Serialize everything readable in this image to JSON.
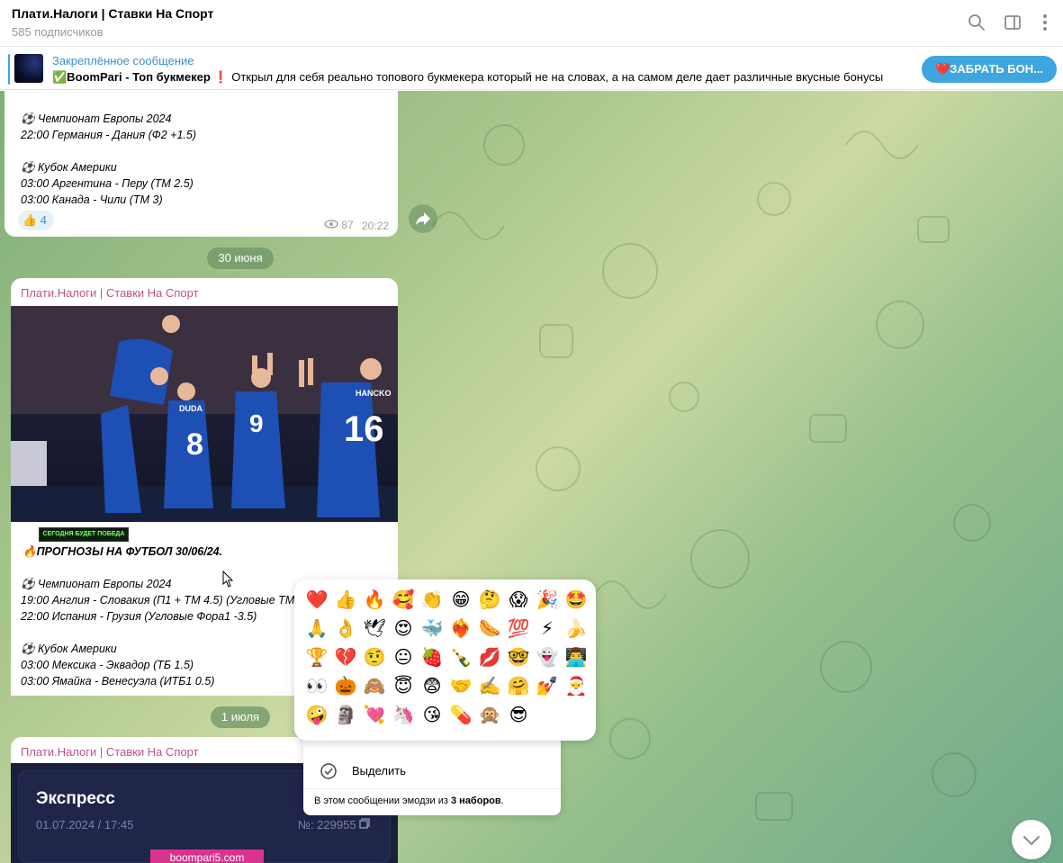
{
  "header": {
    "title": "Плати.Налоги | Ставки На Спорт",
    "subtitle": "585 подписчиков"
  },
  "pinned": {
    "label": "Закреплённое сообщение",
    "title_bold": "✅BoomPari - Топ букмекер",
    "text": " ❗ Открыл для себя реально топового букмекера который не на словах, а на самом деле дает различные вкусные бонусы",
    "button": "❤️ЗАБРАТЬ БОН..."
  },
  "msg1": {
    "lines": [
      "⚽ Чемпионат Европы 2024",
      "22:00 Германия - Дания (Ф2 +1.5)",
      "",
      "⚽ Кубок Америки",
      "03:00 Аргентина - Перу (ТМ 2.5)",
      "03:00 Канада - Чили (ТМ 3)"
    ],
    "reaction": "👍 4",
    "views": "87",
    "time": "20:22"
  },
  "date1": "30 июня",
  "msg2": {
    "sender": "Плати.Налоги | Ставки На Спорт",
    "banner": "СЕГОДНЯ БУДЕТ ПОБЕДА",
    "headline": "🔥ПРОГНОЗЫ НА ФУТБОЛ 30/06/24.",
    "lines": [
      "⚽ Чемпионат Европы 2024",
      "19:00 Англия - Словакия (П1 + ТМ 4.5) (Угловые ТМ 9",
      "22:00 Испания - Грузия (Угловые Фора1 -3.5)",
      "",
      "⚽ Кубок Америки",
      "03:00 Мексика - Эквадор (ТБ 1.5)",
      "03:00 Ямайка - Венесуэла (ИТБ1 0.5)"
    ],
    "player_numbers": [
      "8",
      "9",
      "16"
    ],
    "jersey_names": [
      "DUDA",
      "HANCKO"
    ]
  },
  "date2": "1 июля",
  "msg3": {
    "sender": "Плати.Налоги | Ставки На Спорт",
    "card_title": "Экспресс",
    "card_date": "01.07.2024 / 17:45",
    "card_number": "№: 229955",
    "card_link": "boompari5.com"
  },
  "emoji_picker": {
    "emojis": [
      "❤️",
      "👍",
      "🔥",
      "🥰",
      "👏",
      "😁",
      "🤔",
      "😱",
      "🎉",
      "🤩",
      "🙏",
      "👌",
      "🕊",
      "😍",
      "🐳",
      "❤️‍🔥",
      "🌭",
      "💯",
      "⚡",
      "🍌",
      "🏆",
      "💔",
      "🤨",
      "😐",
      "🍓",
      "🍾",
      "💋",
      "🤓",
      "👻",
      "👨‍💻",
      "👀",
      "🎃",
      "🙈",
      "😇",
      "😨",
      "🤝",
      "✍️",
      "🤗",
      "💅",
      "🎅",
      "🤪",
      "🗿",
      "💘",
      "🦄",
      "😘",
      "💊",
      "🙊",
      "😎"
    ]
  },
  "context_menu": {
    "item_select": "Выделить",
    "note_prefix": "В этом сообщении эмодзи из ",
    "note_bold": "3 наборов",
    "note_suffix": "."
  },
  "colors": {
    "accent": "#3ea5df",
    "sender": "#c0547c",
    "pinned_label": "#3a8fd0"
  }
}
